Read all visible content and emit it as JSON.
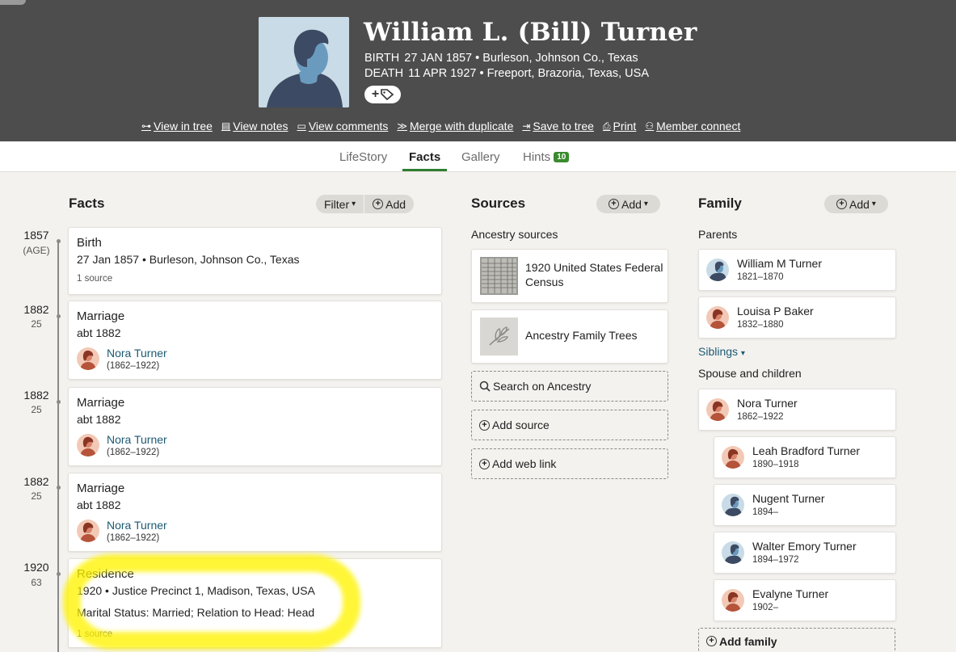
{
  "person": {
    "name": "William L. (Bill) Turner",
    "birth_label": "BIRTH",
    "birth_value": "27 JAN 1857 • Burleson, Johnson Co., Texas",
    "death_label": "DEATH",
    "death_value": "11 APR 1927 • Freeport, Brazoria, Texas, USA"
  },
  "actions": [
    {
      "label": "View in tree",
      "icon": "tree-icon"
    },
    {
      "label": "View notes",
      "icon": "notes-icon"
    },
    {
      "label": "View comments",
      "icon": "comments-icon"
    },
    {
      "label": "Merge with duplicate",
      "icon": "merge-icon"
    },
    {
      "label": "Save to tree",
      "icon": "save-icon"
    },
    {
      "label": "Print",
      "icon": "print-icon"
    },
    {
      "label": "Member connect",
      "icon": "members-icon"
    }
  ],
  "tabs": [
    {
      "label": "LifeStory"
    },
    {
      "label": "Facts",
      "active": true
    },
    {
      "label": "Gallery"
    },
    {
      "label": "Hints",
      "badge": "10"
    }
  ],
  "facts_section": {
    "title": "Facts",
    "filter_label": "Filter",
    "add_label": "Add",
    "items": [
      {
        "year": "1857",
        "age": "(AGE)",
        "title": "Birth",
        "date": "27 Jan 1857 • Burleson, Johnson Co., Texas",
        "source": "1 source"
      },
      {
        "year": "1882",
        "age": "25",
        "title": "Marriage",
        "date": "abt 1882",
        "spouse_name": "Nora Turner",
        "spouse_years": "(1862–1922)"
      },
      {
        "year": "1882",
        "age": "25",
        "title": "Marriage",
        "date": "abt 1882",
        "spouse_name": "Nora Turner",
        "spouse_years": "(1862–1922)"
      },
      {
        "year": "1882",
        "age": "25",
        "title": "Marriage",
        "date": "abt 1882",
        "spouse_name": "Nora Turner",
        "spouse_years": "(1862–1922)"
      },
      {
        "year": "1920",
        "age": "63",
        "title": "Residence",
        "date": "1920 • Justice Precinct 1, Madison, Texas, USA",
        "description": "Marital Status: Married; Relation to Head: Head",
        "source": "1 source"
      }
    ]
  },
  "sources_section": {
    "title": "Sources",
    "add_label": "Add",
    "ancestry_label": "Ancestry sources",
    "items": [
      {
        "label": "1920 United States Federal Census",
        "icon": "census-document-thumbnail"
      },
      {
        "label": "Ancestry Family Trees",
        "icon": "leaf-icon"
      }
    ],
    "search_label": "Search on Ancestry",
    "add_source_label": "Add source",
    "add_weblink_label": "Add web link"
  },
  "family_section": {
    "title": "Family",
    "add_label": "Add",
    "parents_label": "Parents",
    "parents": [
      {
        "name": "William M Turner",
        "years": "1821–1870",
        "gender": "male"
      },
      {
        "name": "Louisa P Baker",
        "years": "1832–1880",
        "gender": "female"
      }
    ],
    "siblings_label": "Siblings",
    "spouse_label": "Spouse and children",
    "spouse": {
      "name": "Nora Turner",
      "years": "1862–1922",
      "gender": "female"
    },
    "children": [
      {
        "name": "Leah Bradford Turner",
        "years": "1890–1918",
        "gender": "female"
      },
      {
        "name": "Nugent Turner",
        "years": "1894–",
        "gender": "male"
      },
      {
        "name": "Walter Emory Turner",
        "years": "1894–1972",
        "gender": "male"
      },
      {
        "name": "Evalyne Turner",
        "years": "1902–",
        "gender": "female"
      }
    ],
    "add_family_label": "Add family"
  },
  "colors": {
    "header_bg": "#4d4d4d",
    "page_bg": "#f4f2ef",
    "link": "#1c5a73",
    "tab_accent": "#2e7d32",
    "highlight": "#fff400"
  }
}
